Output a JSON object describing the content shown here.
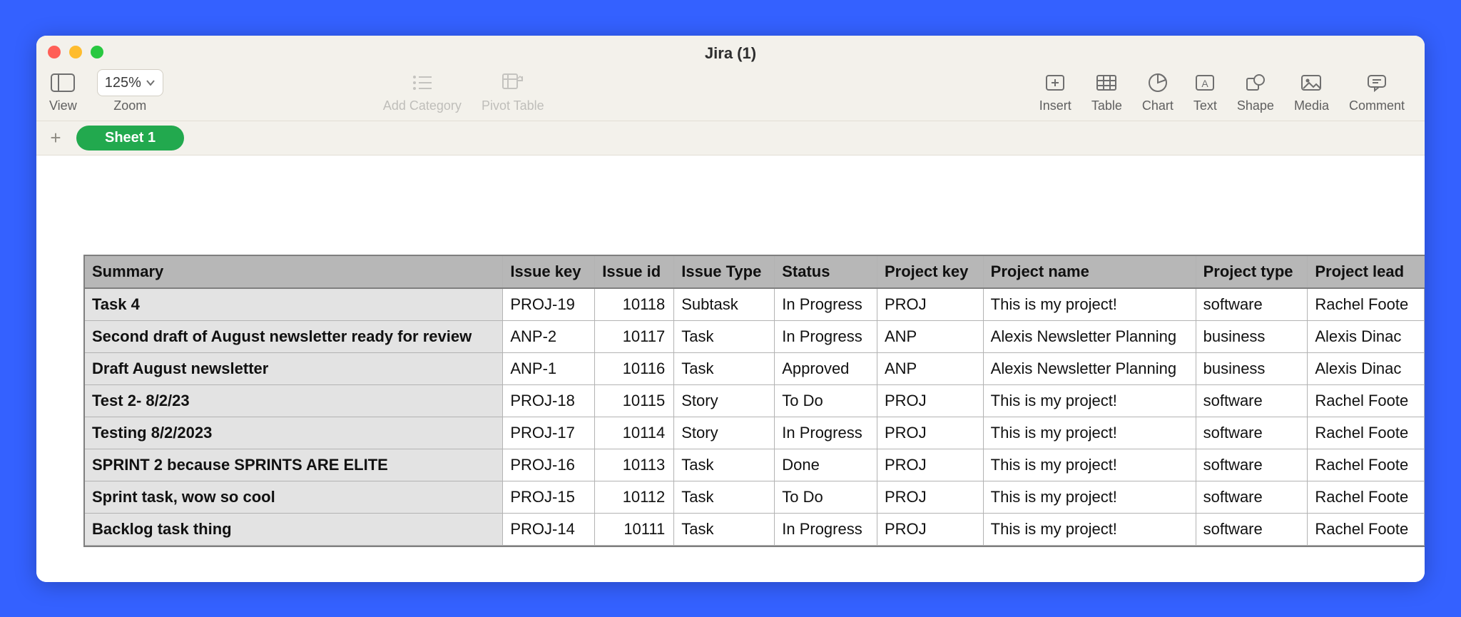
{
  "window": {
    "title": "Jira (1)"
  },
  "toolbar": {
    "view_label": "View",
    "zoom_label": "Zoom",
    "zoom_value": "125%",
    "add_category_label": "Add Category",
    "pivot_table_label": "Pivot Table",
    "insert_label": "Insert",
    "table_label": "Table",
    "chart_label": "Chart",
    "text_label": "Text",
    "shape_label": "Shape",
    "media_label": "Media",
    "comment_label": "Comment"
  },
  "sheets": {
    "active": "Sheet 1"
  },
  "table": {
    "headers": [
      "Summary",
      "Issue key",
      "Issue id",
      "Issue Type",
      "Status",
      "Project key",
      "Project name",
      "Project type",
      "Project lead"
    ],
    "rows": [
      {
        "summary": "Task 4",
        "issue_key": "PROJ-19",
        "issue_id": "10118",
        "issue_type": "Subtask",
        "status": "In Progress",
        "project_key": "PROJ",
        "project_name": "This is my project!",
        "project_type": "software",
        "project_lead": "Rachel Foote"
      },
      {
        "summary": "Second draft of August newsletter ready for review",
        "issue_key": "ANP-2",
        "issue_id": "10117",
        "issue_type": "Task",
        "status": "In Progress",
        "project_key": "ANP",
        "project_name": "Alexis Newsletter Planning",
        "project_type": "business",
        "project_lead": "Alexis Dinac"
      },
      {
        "summary": "Draft August newsletter",
        "issue_key": "ANP-1",
        "issue_id": "10116",
        "issue_type": "Task",
        "status": "Approved",
        "project_key": "ANP",
        "project_name": "Alexis Newsletter Planning",
        "project_type": "business",
        "project_lead": "Alexis Dinac"
      },
      {
        "summary": "Test 2- 8/2/23",
        "issue_key": "PROJ-18",
        "issue_id": "10115",
        "issue_type": "Story",
        "status": "To Do",
        "project_key": "PROJ",
        "project_name": "This is my project!",
        "project_type": "software",
        "project_lead": "Rachel Foote"
      },
      {
        "summary": "Testing 8/2/2023",
        "issue_key": "PROJ-17",
        "issue_id": "10114",
        "issue_type": "Story",
        "status": "In Progress",
        "project_key": "PROJ",
        "project_name": "This is my project!",
        "project_type": "software",
        "project_lead": "Rachel Foote"
      },
      {
        "summary": "SPRINT 2 because SPRINTS ARE ELITE",
        "issue_key": "PROJ-16",
        "issue_id": "10113",
        "issue_type": "Task",
        "status": "Done",
        "project_key": "PROJ",
        "project_name": "This is my project!",
        "project_type": "software",
        "project_lead": "Rachel Foote"
      },
      {
        "summary": "Sprint task, wow so cool",
        "issue_key": "PROJ-15",
        "issue_id": "10112",
        "issue_type": "Task",
        "status": "To Do",
        "project_key": "PROJ",
        "project_name": "This is my project!",
        "project_type": "software",
        "project_lead": "Rachel Foote"
      },
      {
        "summary": "Backlog task thing",
        "issue_key": "PROJ-14",
        "issue_id": "10111",
        "issue_type": "Task",
        "status": "In Progress",
        "project_key": "PROJ",
        "project_name": "This is my project!",
        "project_type": "software",
        "project_lead": "Rachel Foote"
      }
    ]
  }
}
